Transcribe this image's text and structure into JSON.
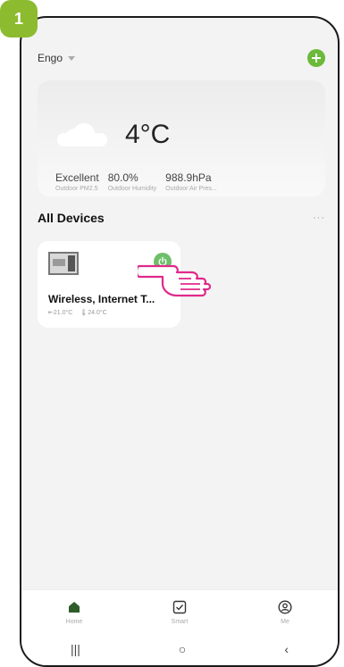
{
  "step": {
    "number": "1"
  },
  "topbar": {
    "home_name": "Engo"
  },
  "weather": {
    "temperature": "4°C",
    "stats": [
      {
        "value": "Excellent",
        "label": "Outdoor PM2.5"
      },
      {
        "value": "80.0%",
        "label": "Outdoor Humidity"
      },
      {
        "value": "988.9hPa",
        "label": "Outdoor Air Pres..."
      }
    ]
  },
  "devices_section": {
    "title": "All Devices",
    "more": "···"
  },
  "device": {
    "name": "Wireless, Internet T...",
    "set_temp": "21.0°C",
    "current_temp": "24.0°C"
  },
  "nav": {
    "home": "Home",
    "smart": "Smart",
    "me": "Me"
  },
  "system_nav": {
    "recents": "|||",
    "home": "○",
    "back": "‹"
  },
  "colors": {
    "accent": "#8dbb2f",
    "add": "#6cb93b",
    "power": "#6fbf6a",
    "pointer": "#e0298a"
  }
}
